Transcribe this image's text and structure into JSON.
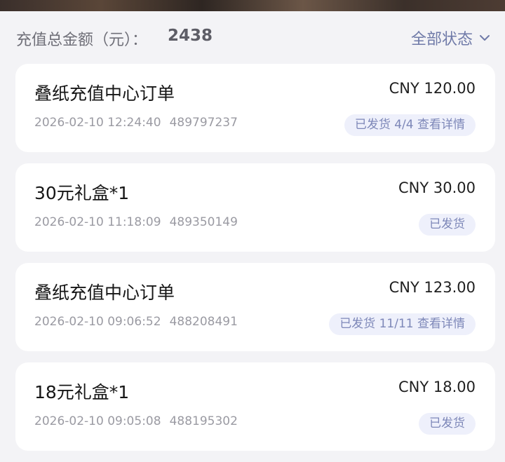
{
  "summary": {
    "label": "充值总金额（元）：",
    "amount": "2438",
    "filter_label": "全部状态",
    "filter_icon": "chevron-down-icon"
  },
  "orders": [
    {
      "title": "叠纸充值中心订单",
      "amount": "CNY 120.00",
      "datetime": "2026-02-10 12:24:40",
      "order_id": "489797237",
      "status": "已发货 4/4 查看详情"
    },
    {
      "title": "30元礼盒*1",
      "amount": "CNY 30.00",
      "datetime": "2026-02-10 11:18:09",
      "order_id": "489350149",
      "status": "已发货"
    },
    {
      "title": "叠纸充值中心订单",
      "amount": "CNY 123.00",
      "datetime": "2026-02-10 09:06:52",
      "order_id": "488208491",
      "status": "已发货 11/11 查看详情"
    },
    {
      "title": "18元礼盒*1",
      "amount": "CNY 18.00",
      "datetime": "2026-02-10 09:05:08",
      "order_id": "488195302",
      "status": "已发货"
    }
  ],
  "colors": {
    "page_background": "#f3f3f6",
    "card_background": "#ffffff",
    "accent": "#6f7aa8",
    "badge_background": "#eef0fb",
    "badge_text": "#7d87b8"
  }
}
